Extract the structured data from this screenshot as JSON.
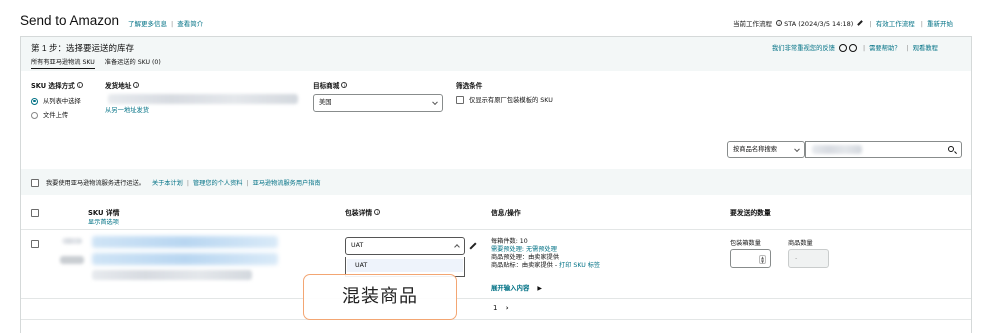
{
  "header": {
    "title": "Send to Amazon",
    "learn_more": "了解更多信息",
    "view_intro": "查看简介",
    "workflow_label": "当前工作流程",
    "workflow_value": "STA (2024/3/5 14:18)",
    "active_workflows": "有效工作流程",
    "restart": "重新开始"
  },
  "step": {
    "title": "第 1 步：选择要运送的库存",
    "tabs": [
      {
        "label": "所有有亚马逊物流 SKU",
        "active": true
      },
      {
        "label": "准备运送的 SKU (0)",
        "active": false
      }
    ],
    "feedback": "我们非常重视您的反馈",
    "need_help": "需要帮助？",
    "view_tutorial": "观看教程"
  },
  "filters": {
    "sku_method_label": "SKU 选择方式",
    "sku_method_options": [
      {
        "label": "从列表中选择",
        "selected": true
      },
      {
        "label": "文件上传",
        "selected": false
      }
    ],
    "ship_from_label": "发货地址",
    "ship_from_link": "从另一地址发货",
    "marketplace_label": "目标商城",
    "marketplace_value": "美国",
    "conditions_label": "筛选条件",
    "conditions_checkbox": "仅显示有原厂包装模板的 SKU"
  },
  "search": {
    "type_value": "按商品名称搜索"
  },
  "partnered": {
    "checkbox_label": "我要使用亚马逊物流服务进行运送。",
    "about": "关于本计划",
    "manage_profile": "管理您的个人资料",
    "guide": "亚马逊物流服务用户指南"
  },
  "table": {
    "headers": {
      "sku_details": "SKU 详情",
      "show_selected": "显示首选项",
      "packing_details": "包装详情",
      "info_action": "信息/操作",
      "qty_to_ship": "要发送的数量"
    },
    "row": {
      "packing_select_value": "UAT",
      "dropdown_option": "UAT",
      "units_per_box": "每箱件数: 10",
      "prep_required": "需要预处理: 无需预处理",
      "item_prep": "商品预处理：由卖家提供",
      "item_label_prefix": "商品贴标：由卖家提供 - ",
      "print_label": "打印 SKU 标签",
      "expand_input": "展开输入内容",
      "box_qty_label": "包装箱数量",
      "item_qty_label": "商品数量"
    }
  },
  "pagination": {
    "page": "1"
  },
  "overlay": {
    "caption": "混装商品"
  }
}
